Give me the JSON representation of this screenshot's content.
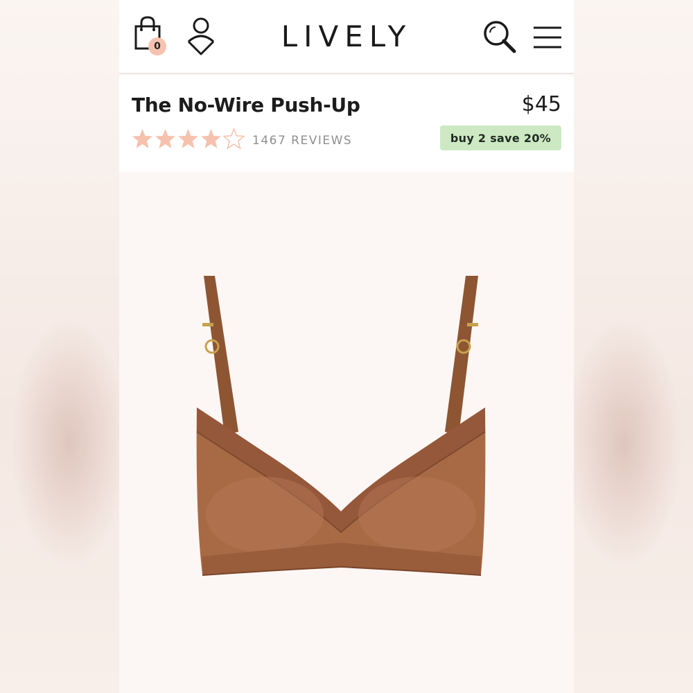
{
  "header": {
    "logo": "LIVELY",
    "cart_count": "0",
    "icons": {
      "cart": "shopping-bag-icon",
      "account": "account-icon",
      "search": "search-icon",
      "menu": "hamburger-menu-icon"
    }
  },
  "product": {
    "title": "The No-Wire Push-Up",
    "price": "$45",
    "rating": 4,
    "rating_max": 5,
    "reviews_label": "1467 REVIEWS",
    "promo": "buy 2 save 20%",
    "image_alt": "Brown no-wire push-up bra",
    "color": "#a86a45"
  },
  "colors": {
    "star_filled": "#f6c1ad",
    "promo_bg": "#cde9c3",
    "badge_bg": "#f6c3b1",
    "text": "#1c1c1c"
  }
}
